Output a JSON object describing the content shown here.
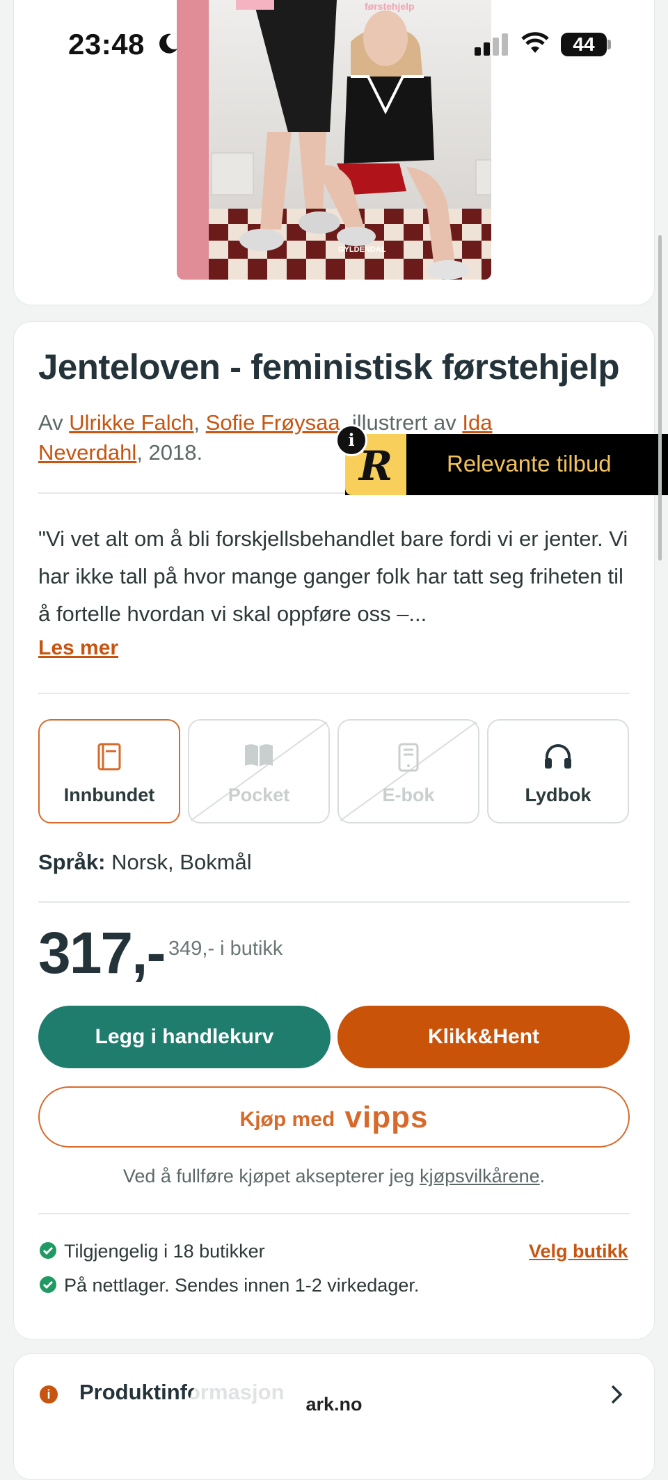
{
  "status": {
    "time": "23:48",
    "battery": "44"
  },
  "cover": {
    "publisher": "GYLDENDAL",
    "top_text": "førstehjelp"
  },
  "book": {
    "title": "Jenteloven - feministisk førstehjelp",
    "by_prefix": "Av",
    "author1": "Ulrikke Falch",
    "sep1": ",",
    "author2": "Sofie Frøysaa",
    "illustrated_by": ", illustrert av",
    "illustrator": "Ida Neverdahl",
    "year_suffix": ", 2018.",
    "description": "\"Vi vet alt om å bli forskjellsbehandlet bare fordi vi er jenter. Vi har ikke tall på hvor mange ganger folk har tatt seg friheten til å fortelle hvordan vi skal oppføre oss –...",
    "read_more": "Les mer"
  },
  "formats": [
    {
      "label": "Innbundet",
      "icon": "book-icon",
      "state": "active"
    },
    {
      "label": "Pocket",
      "icon": "open-book-icon",
      "state": "disabled"
    },
    {
      "label": "E-bok",
      "icon": "tablet-icon",
      "state": "disabled"
    },
    {
      "label": "Lydbok",
      "icon": "headphones-icon",
      "state": "available"
    }
  ],
  "language": {
    "label": "Språk:",
    "value": "Norsk, Bokmål"
  },
  "price": {
    "current": "317,-",
    "store": "349,- i butikk"
  },
  "buttons": {
    "cart": "Legg i handlekurv",
    "click_collect": "Klikk&Hent",
    "vipps_prefix": "Kjøp med",
    "vipps_brand": "vipps"
  },
  "terms": {
    "text": "Ved å fullføre kjøpet aksepterer jeg",
    "link": "kjøpsvilkårene",
    "end": "."
  },
  "availability": {
    "stores": "Tilgjengelig i 18 butikker",
    "online": "På nettlager. Sendes innen 1-2 virkedager.",
    "choose_store": "Velg butikk"
  },
  "product_info": {
    "label": "Produktinformasjon"
  },
  "browser": {
    "url": "ark.no"
  },
  "overlay": {
    "label": "Relevante tilbud",
    "logo_letter": "R",
    "info": "i"
  },
  "colors": {
    "accent": "#c7540f",
    "green": "#1f7d6e",
    "check": "#1f9a62"
  }
}
